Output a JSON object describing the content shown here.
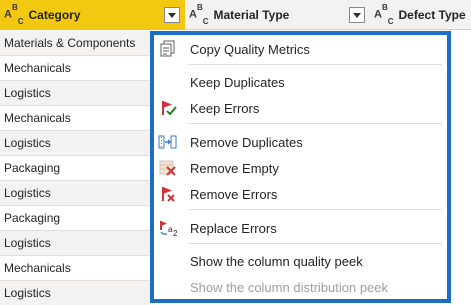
{
  "columns": [
    {
      "type_main": "A",
      "type_sup": "B",
      "type_sub": "C",
      "title": "Category",
      "selected": true
    },
    {
      "type_main": "A",
      "type_sup": "B",
      "type_sub": "C",
      "title": "Material Type",
      "selected": false
    },
    {
      "type_main": "A",
      "type_sup": "B",
      "type_sub": "C",
      "title": "Defect Type",
      "selected": false
    }
  ],
  "rows": [
    "Materials & Components",
    "Mechanicals",
    "Logistics",
    "Mechanicals",
    "Logistics",
    "Packaging",
    "Logistics",
    "Packaging",
    "Logistics",
    "Mechanicals",
    "Logistics"
  ],
  "menu": {
    "items": [
      {
        "label": "Copy Quality Metrics",
        "icon": "copy-icon"
      },
      {
        "label": "Keep Duplicates",
        "icon": ""
      },
      {
        "label": "Keep Errors",
        "icon": "keep-errors-icon"
      },
      {
        "label": "Remove Duplicates",
        "icon": "remove-duplicates-icon"
      },
      {
        "label": "Remove Empty",
        "icon": "remove-empty-icon"
      },
      {
        "label": "Remove Errors",
        "icon": "remove-errors-icon"
      },
      {
        "label": "Replace Errors",
        "icon": "replace-errors-icon"
      },
      {
        "label": "Show the column quality peek",
        "icon": ""
      },
      {
        "label": "Show the column distribution peek",
        "icon": "",
        "disabled": true
      }
    ]
  },
  "colors": {
    "selected_header": "#f2c811",
    "menu_border": "#1a6fc2",
    "error_red": "#d13438",
    "check_green": "#107c10"
  }
}
